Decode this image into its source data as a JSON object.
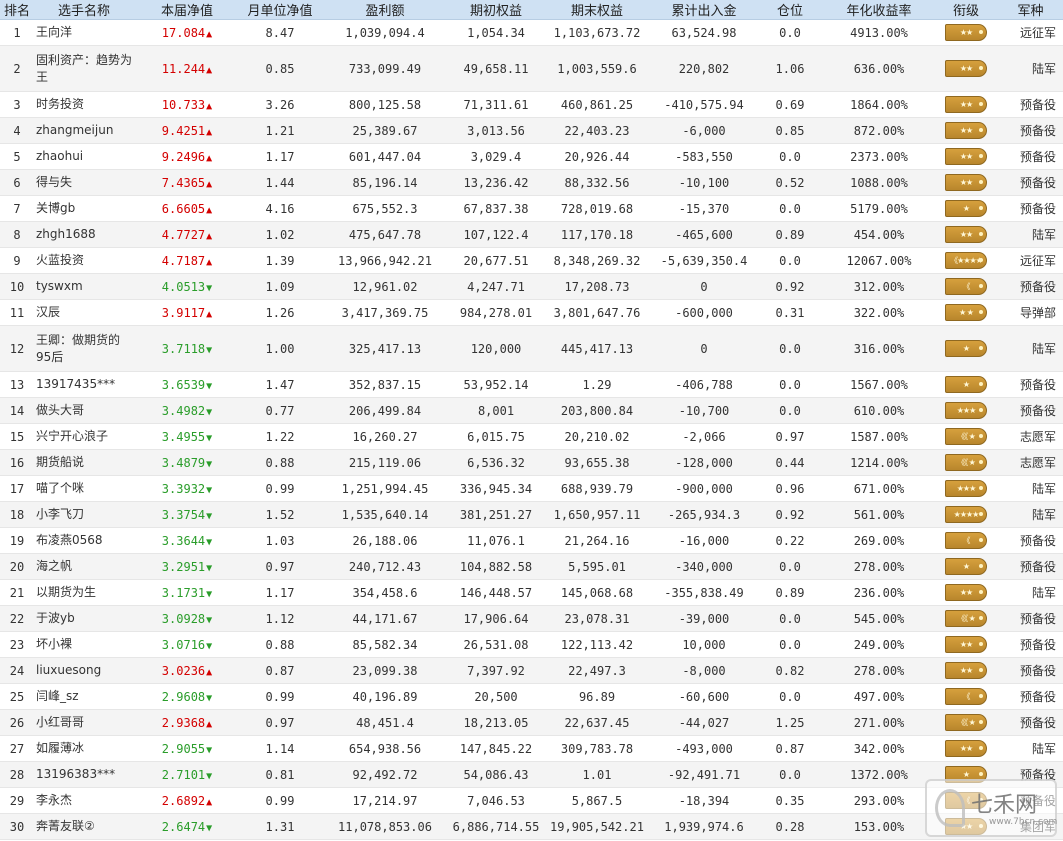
{
  "colors": {
    "header_bg": "#cfe1f3",
    "up": "#d40000",
    "down": "#2a9d2a",
    "badge": "#c7922f"
  },
  "headers": [
    "排名",
    "选手名称",
    "本届净值",
    "月单位净值",
    "盈利额",
    "期初权益",
    "期末权益",
    "累计出入金",
    "仓位",
    "年化收益率",
    "衔级",
    "军种"
  ],
  "rows": [
    {
      "rank": "1",
      "name": "王向洋",
      "net": "17.084",
      "dir": "up",
      "monthly": "8.47",
      "profit": "1,039,094.4",
      "initial": "1,054.34",
      "final": "1,103,673.72",
      "flow": "63,524.98",
      "position": "0.0",
      "annual": "4913.00%",
      "badge": "★★",
      "army": "远征军"
    },
    {
      "rank": "2",
      "name": "固利资产：趋势为王",
      "net": "11.244",
      "dir": "up",
      "monthly": "0.85",
      "profit": "733,099.49",
      "initial": "49,658.11",
      "final": "1,003,559.6",
      "flow": "220,802",
      "position": "1.06",
      "annual": "636.00%",
      "badge": "★★",
      "army": "陆军"
    },
    {
      "rank": "3",
      "name": "时务投资",
      "net": "10.733",
      "dir": "up",
      "monthly": "3.26",
      "profit": "800,125.58",
      "initial": "71,311.61",
      "final": "460,861.25",
      "flow": "-410,575.94",
      "position": "0.69",
      "annual": "1864.00%",
      "badge": "★★",
      "army": "预备役"
    },
    {
      "rank": "4",
      "name": "zhangmeijun",
      "net": "9.4251",
      "dir": "up",
      "monthly": "1.21",
      "profit": "25,389.67",
      "initial": "3,013.56",
      "final": "22,403.23",
      "flow": "-6,000",
      "position": "0.85",
      "annual": "872.00%",
      "badge": "★★",
      "army": "预备役"
    },
    {
      "rank": "5",
      "name": "zhaohui",
      "net": "9.2496",
      "dir": "up",
      "monthly": "1.17",
      "profit": "601,447.04",
      "initial": "3,029.4",
      "final": "20,926.44",
      "flow": "-583,550",
      "position": "0.0",
      "annual": "2373.00%",
      "badge": "★★",
      "army": "预备役"
    },
    {
      "rank": "6",
      "name": "得与失",
      "net": "7.4365",
      "dir": "up",
      "monthly": "1.44",
      "profit": "85,196.14",
      "initial": "13,236.42",
      "final": "88,332.56",
      "flow": "-10,100",
      "position": "0.52",
      "annual": "1088.00%",
      "badge": "★★",
      "army": "预备役"
    },
    {
      "rank": "7",
      "name": "关博gb",
      "net": "6.6605",
      "dir": "up",
      "monthly": "4.16",
      "profit": "675,552.3",
      "initial": "67,837.38",
      "final": "728,019.68",
      "flow": "-15,370",
      "position": "0.0",
      "annual": "5179.00%",
      "badge": "★",
      "army": "预备役"
    },
    {
      "rank": "8",
      "name": "zhgh1688",
      "net": "4.7727",
      "dir": "up",
      "monthly": "1.02",
      "profit": "475,647.78",
      "initial": "107,122.4",
      "final": "117,170.18",
      "flow": "-465,600",
      "position": "0.89",
      "annual": "454.00%",
      "badge": "★★",
      "army": "陆军"
    },
    {
      "rank": "9",
      "name": "火蓝投资",
      "net": "4.7187",
      "dir": "up",
      "monthly": "1.39",
      "profit": "13,966,942.21",
      "initial": "20,677.51",
      "final": "8,348,269.32",
      "flow": "-5,639,350.4",
      "position": "0.0",
      "annual": "12067.00%",
      "badge": "《★★★★",
      "army": "远征军"
    },
    {
      "rank": "10",
      "name": "tyswxm",
      "net": "4.0513",
      "dir": "down",
      "monthly": "1.09",
      "profit": "12,961.02",
      "initial": "4,247.71",
      "final": "17,208.73",
      "flow": "0",
      "position": "0.92",
      "annual": "312.00%",
      "badge": "《",
      "army": "预备役"
    },
    {
      "rank": "11",
      "name": "汉辰",
      "net": "3.9117",
      "dir": "up",
      "monthly": "1.26",
      "profit": "3,417,369.75",
      "initial": "984,278.01",
      "final": "3,801,647.76",
      "flow": "-600,000",
      "position": "0.31",
      "annual": "322.00%",
      "badge": "★ ★",
      "army": "导弹部"
    },
    {
      "rank": "12",
      "name": "王卿：做期货的95后",
      "net": "3.7118",
      "dir": "down",
      "monthly": "1.00",
      "profit": "325,417.13",
      "initial": "120,000",
      "final": "445,417.13",
      "flow": "0",
      "position": "0.0",
      "annual": "316.00%",
      "badge": "★",
      "army": "陆军"
    },
    {
      "rank": "13",
      "name": "13917435***",
      "net": "3.6539",
      "dir": "down",
      "monthly": "1.47",
      "profit": "352,837.15",
      "initial": "53,952.14",
      "final": "1.29",
      "flow": "-406,788",
      "position": "0.0",
      "annual": "1567.00%",
      "badge": "★",
      "army": "预备役"
    },
    {
      "rank": "14",
      "name": "做头大哥",
      "net": "3.4982",
      "dir": "down",
      "monthly": "0.77",
      "profit": "206,499.84",
      "initial": "8,001",
      "final": "203,800.84",
      "flow": "-10,700",
      "position": "0.0",
      "annual": "610.00%",
      "badge": "★★★",
      "army": "预备役"
    },
    {
      "rank": "15",
      "name": "兴宁开心浪子",
      "net": "3.4955",
      "dir": "down",
      "monthly": "1.22",
      "profit": "16,260.27",
      "initial": "6,015.75",
      "final": "20,210.02",
      "flow": "-2,066",
      "position": "0.97",
      "annual": "1587.00%",
      "badge": "《《 ★",
      "army": "志愿军"
    },
    {
      "rank": "16",
      "name": "期货船说",
      "net": "3.4879",
      "dir": "down",
      "monthly": "0.88",
      "profit": "215,119.06",
      "initial": "6,536.32",
      "final": "93,655.38",
      "flow": "-128,000",
      "position": "0.44",
      "annual": "1214.00%",
      "badge": "《《 ★",
      "army": "志愿军"
    },
    {
      "rank": "17",
      "name": "喵了个咪",
      "net": "3.3932",
      "dir": "down",
      "monthly": "0.99",
      "profit": "1,251,994.45",
      "initial": "336,945.34",
      "final": "688,939.79",
      "flow": "-900,000",
      "position": "0.96",
      "annual": "671.00%",
      "badge": "★★★",
      "army": "陆军"
    },
    {
      "rank": "18",
      "name": "小李飞刀",
      "net": "3.3754",
      "dir": "down",
      "monthly": "1.52",
      "profit": "1,535,640.14",
      "initial": "381,251.27",
      "final": "1,650,957.11",
      "flow": "-265,934.3",
      "position": "0.92",
      "annual": "561.00%",
      "badge": "★★★★",
      "army": "陆军"
    },
    {
      "rank": "19",
      "name": "布凌燕0568",
      "net": "3.3644",
      "dir": "down",
      "monthly": "1.03",
      "profit": "26,188.06",
      "initial": "11,076.1",
      "final": "21,264.16",
      "flow": "-16,000",
      "position": "0.22",
      "annual": "269.00%",
      "badge": "《",
      "army": "预备役"
    },
    {
      "rank": "20",
      "name": "海之帆",
      "net": "3.2951",
      "dir": "down",
      "monthly": "0.97",
      "profit": "240,712.43",
      "initial": "104,882.58",
      "final": "5,595.01",
      "flow": "-340,000",
      "position": "0.0",
      "annual": "278.00%",
      "badge": "★",
      "army": "预备役"
    },
    {
      "rank": "21",
      "name": "以期货为生",
      "net": "3.1731",
      "dir": "down",
      "monthly": "1.17",
      "profit": "354,458.6",
      "initial": "146,448.57",
      "final": "145,068.68",
      "flow": "-355,838.49",
      "position": "0.89",
      "annual": "236.00%",
      "badge": "★★",
      "army": "陆军"
    },
    {
      "rank": "22",
      "name": "于波yb",
      "net": "3.0928",
      "dir": "down",
      "monthly": "1.12",
      "profit": "44,171.67",
      "initial": "17,906.64",
      "final": "23,078.31",
      "flow": "-39,000",
      "position": "0.0",
      "annual": "545.00%",
      "badge": "《《 ★",
      "army": "预备役"
    },
    {
      "rank": "23",
      "name": "坏小裸",
      "net": "3.0716",
      "dir": "down",
      "monthly": "0.88",
      "profit": "85,582.34",
      "initial": "26,531.08",
      "final": "122,113.42",
      "flow": "10,000",
      "position": "0.0",
      "annual": "249.00%",
      "badge": "★★",
      "army": "预备役"
    },
    {
      "rank": "24",
      "name": "liuxuesong",
      "net": "3.0236",
      "dir": "up",
      "monthly": "0.87",
      "profit": "23,099.38",
      "initial": "7,397.92",
      "final": "22,497.3",
      "flow": "-8,000",
      "position": "0.82",
      "annual": "278.00%",
      "badge": "★★",
      "army": "预备役"
    },
    {
      "rank": "25",
      "name": "闫峰_sz",
      "net": "2.9608",
      "dir": "down",
      "monthly": "0.99",
      "profit": "40,196.89",
      "initial": "20,500",
      "final": "96.89",
      "flow": "-60,600",
      "position": "0.0",
      "annual": "497.00%",
      "badge": "《",
      "army": "预备役"
    },
    {
      "rank": "26",
      "name": "小红哥哥",
      "net": "2.9368",
      "dir": "up",
      "monthly": "0.97",
      "profit": "48,451.4",
      "initial": "18,213.05",
      "final": "22,637.45",
      "flow": "-44,027",
      "position": "1.25",
      "annual": "271.00%",
      "badge": "《《 ★",
      "army": "预备役"
    },
    {
      "rank": "27",
      "name": "如履薄冰",
      "net": "2.9055",
      "dir": "down",
      "monthly": "1.14",
      "profit": "654,938.56",
      "initial": "147,845.22",
      "final": "309,783.78",
      "flow": "-493,000",
      "position": "0.87",
      "annual": "342.00%",
      "badge": "★★",
      "army": "陆军"
    },
    {
      "rank": "28",
      "name": "13196383***",
      "net": "2.7101",
      "dir": "down",
      "monthly": "0.81",
      "profit": "92,492.72",
      "initial": "54,086.43",
      "final": "1.01",
      "flow": "-92,491.71",
      "position": "0.0",
      "annual": "1372.00%",
      "badge": "★",
      "army": "预备役"
    },
    {
      "rank": "29",
      "name": "李永杰",
      "net": "2.6892",
      "dir": "up",
      "monthly": "0.99",
      "profit": "17,214.97",
      "initial": "7,046.53",
      "final": "5,867.5",
      "flow": "-18,394",
      "position": "0.35",
      "annual": "293.00%",
      "badge": "《",
      "army": "预备役"
    },
    {
      "rank": "30",
      "name": "奔菁友联②",
      "net": "2.6474",
      "dir": "down",
      "monthly": "1.31",
      "profit": "11,078,853.06",
      "initial": "6,886,714.55",
      "final": "19,905,542.21",
      "flow": "1,939,974.6",
      "position": "0.28",
      "annual": "153.00%",
      "badge": "★★",
      "army": "集团军"
    }
  ],
  "watermark": {
    "title": "七禾网",
    "url": "www.7hcn.com"
  }
}
